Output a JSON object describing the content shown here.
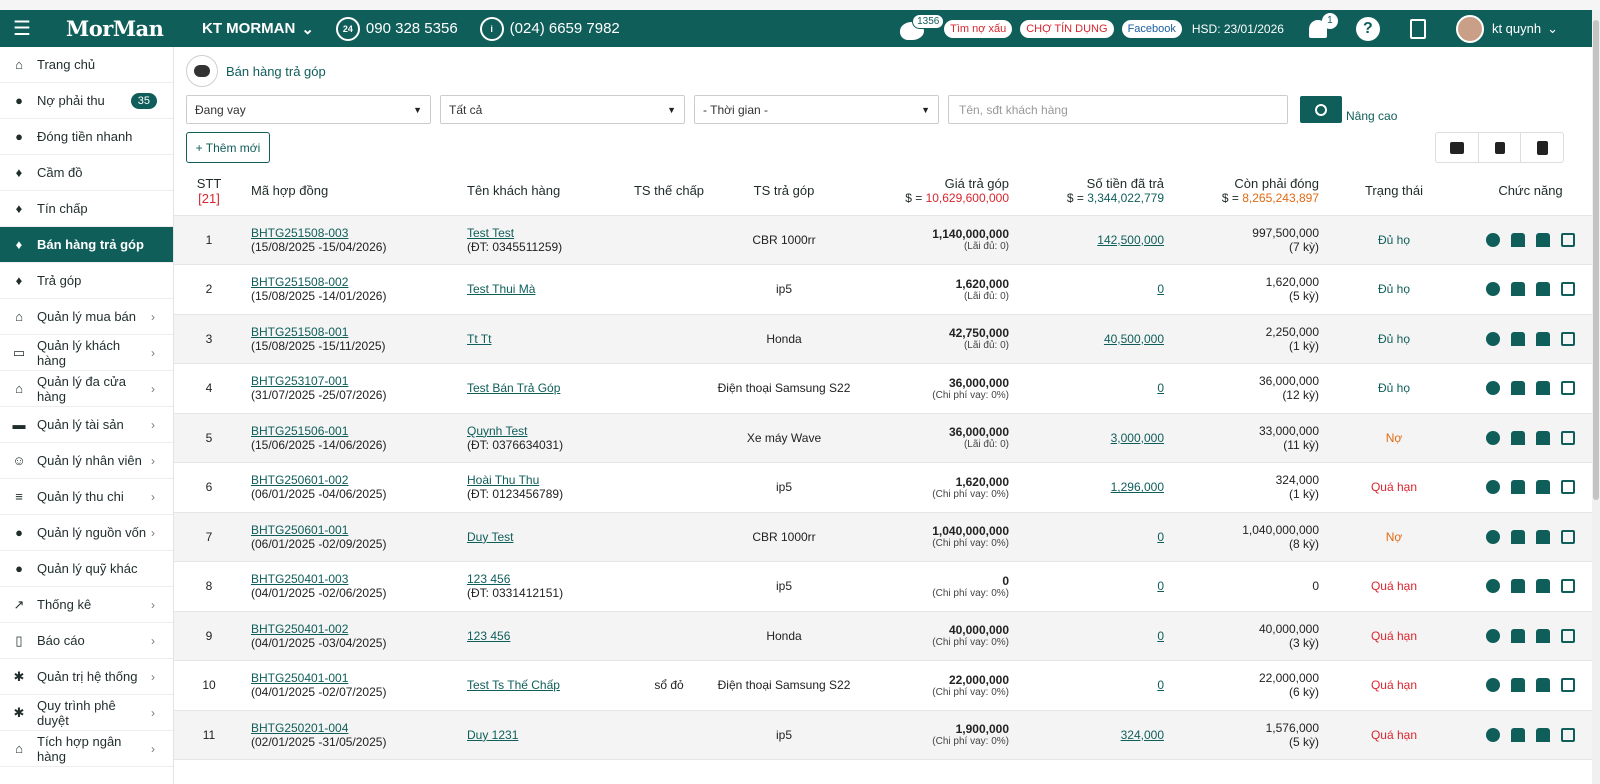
{
  "header": {
    "logo": "MorMan",
    "company": "KT MORMAN",
    "phone1": "090 328 5356",
    "phone2": "(024) 6659 7982",
    "phone1_icon": "24",
    "phone2_icon": "i",
    "msg_count": "1356",
    "pill1": "Tìm nợ xấu",
    "pill2": "CHỢ TÍN DỤNG",
    "pill3": "Facebook",
    "hsd": "HSD: 23/01/2026",
    "bell_count": "1",
    "help": "?",
    "user": "kt quynh"
  },
  "sidebar": {
    "items": [
      {
        "label": "Trang chủ",
        "icon": "home-icon"
      },
      {
        "label": "Nợ phải thu",
        "badge": "35",
        "icon": "money-icon"
      },
      {
        "label": "Đóng tiền nhanh",
        "icon": "money-icon"
      },
      {
        "label": "Cầm đồ",
        "icon": "hand-icon"
      },
      {
        "label": "Tín chấp",
        "icon": "hand-icon"
      },
      {
        "label": "Bán hàng trả góp",
        "icon": "hand-icon"
      },
      {
        "label": "Trả góp",
        "icon": "hand-icon"
      },
      {
        "label": "Quản lý mua bán",
        "icon": "home-icon"
      },
      {
        "label": "Quản lý khách hàng",
        "icon": "id-card-icon"
      },
      {
        "label": "Quản lý đa cửa hàng",
        "icon": "home-icon"
      },
      {
        "label": "Quản lý tài sản",
        "icon": "car-icon"
      },
      {
        "label": "Quản lý nhân viên",
        "icon": "users-icon"
      },
      {
        "label": "Quản lý thu chi",
        "icon": "coins-icon"
      },
      {
        "label": "Quản lý nguồn vốn",
        "icon": "fund-icon"
      },
      {
        "label": "Quản lý quỹ khác",
        "icon": "fund-icon"
      },
      {
        "label": "Thống kê",
        "icon": "chart-icon"
      },
      {
        "label": "Báo cáo",
        "icon": "report-icon"
      },
      {
        "label": "Quản trị hệ thống",
        "icon": "gears-icon"
      },
      {
        "label": "Quy trình phê duyệt",
        "icon": "gears-icon"
      },
      {
        "label": "Tích hợp ngân hàng",
        "icon": "bank-icon"
      }
    ]
  },
  "page": {
    "title": "Bán hàng trả góp",
    "filter1": "Đang vay",
    "filter2": "Tất cả",
    "filter3": "- Thời gian -",
    "search_placeholder": "Tên, sđt khách hàng",
    "advanced": "Nâng cao",
    "add_button": "+ Thêm mới"
  },
  "table": {
    "headers": {
      "stt": "STT",
      "stt_count": "[21]",
      "ma": "Mã hợp đồng",
      "ten": "Tên khách hàng",
      "ts": "TS thế chấp",
      "tg": "TS trả góp",
      "gia": "Giá trả góp",
      "gia_sum": "10,629,600,000",
      "da": "Số tiền đã trả",
      "da_sum": "3,344,022,779",
      "con": "Còn phải đóng",
      "con_sum": "8,265,243,897",
      "tt": "Trạng thái",
      "cn": "Chức năng",
      "currency": "$ ="
    },
    "rows": [
      {
        "stt": "1",
        "code": "BHTG251508-003",
        "dates": "(15/08/2025 -15/04/2026)",
        "name": "Test Test",
        "phone": "(ĐT: 0345511259)",
        "ts": "",
        "tg": "CBR 1000rr",
        "gia": "1,140,000,000",
        "gia_sub": "(Lãi đủ: 0)",
        "da": "142,500,000",
        "con": "997,500,000",
        "con_sub": "(7 kỳ)",
        "status": "Đủ họ"
      },
      {
        "stt": "2",
        "code": "BHTG251508-002",
        "dates": "(15/08/2025 -14/01/2026)",
        "name": "Test Thui Mà",
        "phone": "",
        "ts": "",
        "tg": "ip5",
        "gia": "1,620,000",
        "gia_sub": "(Lãi đủ: 0)",
        "da": "0",
        "con": "1,620,000",
        "con_sub": "(5 kỳ)",
        "status": "Đủ họ"
      },
      {
        "stt": "3",
        "code": "BHTG251508-001",
        "dates": "(15/08/2025 -15/11/2025)",
        "name": "Tt Tt",
        "phone": "",
        "ts": "",
        "tg": "Honda",
        "gia": "42,750,000",
        "gia_sub": "(Lãi đủ: 0)",
        "da": "40,500,000",
        "con": "2,250,000",
        "con_sub": "(1 kỳ)",
        "status": "Đủ họ"
      },
      {
        "stt": "4",
        "code": "BHTG253107-001",
        "dates": "(31/07/2025 -25/07/2026)",
        "name": "Test Bán Trả Góp",
        "phone": "",
        "ts": "",
        "tg": "Điện thoại Samsung S22",
        "gia": "36,000,000",
        "gia_sub": "(Chi phí vay: 0%)",
        "da": "0",
        "con": "36,000,000",
        "con_sub": "(12 kỳ)",
        "status": "Đủ họ"
      },
      {
        "stt": "5",
        "code": "BHTG251506-001",
        "dates": "(15/06/2025 -14/06/2026)",
        "name": "Quynh Test",
        "phone": "(ĐT: 0376634031)",
        "ts": "",
        "tg": "Xe máy Wave",
        "gia": "36,000,000",
        "gia_sub": "(Lãi đủ: 0)",
        "da": "3,000,000",
        "con": "33,000,000",
        "con_sub": "(11 kỳ)",
        "status": "Nợ"
      },
      {
        "stt": "6",
        "code": "BHTG250601-002",
        "dates": "(06/01/2025 -04/06/2025)",
        "name": "Hoài Thu Thu",
        "phone": "(ĐT: 0123456789)",
        "ts": "",
        "tg": "ip5",
        "gia": "1,620,000",
        "gia_sub": "(Chi phí vay: 0%)",
        "da": "1,296,000",
        "con": "324,000",
        "con_sub": "(1 kỳ)",
        "status": "Quá hạn"
      },
      {
        "stt": "7",
        "code": "BHTG250601-001",
        "dates": "(06/01/2025 -02/09/2025)",
        "name": "Duy Test",
        "phone": "",
        "ts": "",
        "tg": "CBR 1000rr",
        "gia": "1,040,000,000",
        "gia_sub": "(Chi phí vay: 0%)",
        "da": "0",
        "con": "1,040,000,000",
        "con_sub": "(8 kỳ)",
        "status": "Nợ"
      },
      {
        "stt": "8",
        "code": "BHTG250401-003",
        "dates": "(04/01/2025 -02/06/2025)",
        "name": "123 456",
        "phone": "(ĐT: 0331412151)",
        "ts": "",
        "tg": "ip5",
        "gia": "0",
        "gia_sub": "(Chi phí vay: 0%)",
        "da": "0",
        "con": "0",
        "con_sub": "",
        "status": "Quá hạn"
      },
      {
        "stt": "9",
        "code": "BHTG250401-002",
        "dates": "(04/01/2025 -03/04/2025)",
        "name": "123 456",
        "phone": "",
        "ts": "",
        "tg": "Honda",
        "gia": "40,000,000",
        "gia_sub": "(Chi phí vay: 0%)",
        "da": "0",
        "con": "40,000,000",
        "con_sub": "(3 kỳ)",
        "status": "Quá hạn"
      },
      {
        "stt": "10",
        "code": "BHTG250401-001",
        "dates": "(04/01/2025 -02/07/2025)",
        "name": "Test Ts Thế Chấp",
        "phone": "",
        "ts": "sổ đỏ",
        "tg": "Điện thoại Samsung S22",
        "gia": "22,000,000",
        "gia_sub": "(Chi phí vay: 0%)",
        "da": "0",
        "con": "22,000,000",
        "con_sub": "(6 kỳ)",
        "status": "Quá hạn"
      },
      {
        "stt": "11",
        "code": "BHTG250201-004",
        "dates": "(02/01/2025 -31/05/2025)",
        "name": "Duy 1231",
        "phone": "",
        "ts": "",
        "tg": "ip5",
        "gia": "1,900,000",
        "gia_sub": "(Chi phí vay: 0%)",
        "da": "324,000",
        "con": "1,576,000",
        "con_sub": "(5 kỳ)",
        "status": "Quá hạn"
      }
    ]
  },
  "colors": {
    "primary": "#0f5e5a",
    "red": "#d8272f",
    "orange": "#e26a12"
  }
}
